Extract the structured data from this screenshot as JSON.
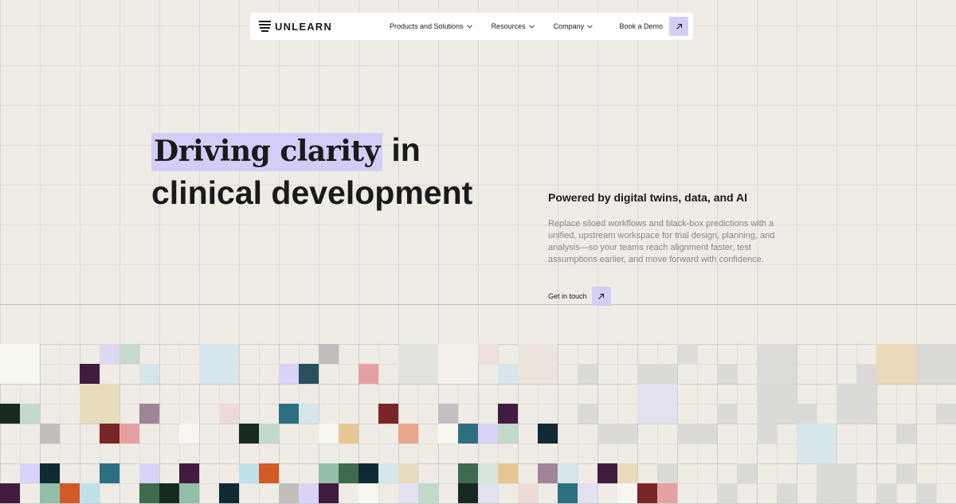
{
  "nav": {
    "brand": "UNLEARN",
    "links": [
      {
        "label": "Products and Solutions"
      },
      {
        "label": "Resources"
      },
      {
        "label": "Company"
      }
    ],
    "demo_label": "Book a Demo"
  },
  "hero": {
    "title_highlight": "Driving clarity",
    "title_rest_1": " in",
    "title_line_2": "clinical development",
    "subhead": "Powered by digital twins, data, and AI",
    "body": "Replace siloed workflows and black-box predictions with a unified, upstream workspace for trial design, planning, and analysis—so your teams reach alignment faster, test assumptions earlier, and move forward with confidence.",
    "cta_label": "Get in touch"
  },
  "colors": {
    "background": "#efebe5",
    "accent_lavender": "#d4cdf7",
    "text_dark": "#1a1a1a",
    "text_muted": "#8a8782"
  },
  "icons": {
    "logo": "stacked-lines-logo-icon",
    "dropdown": "chevron-down-icon",
    "cta": "arrow-up-right-icon"
  }
}
